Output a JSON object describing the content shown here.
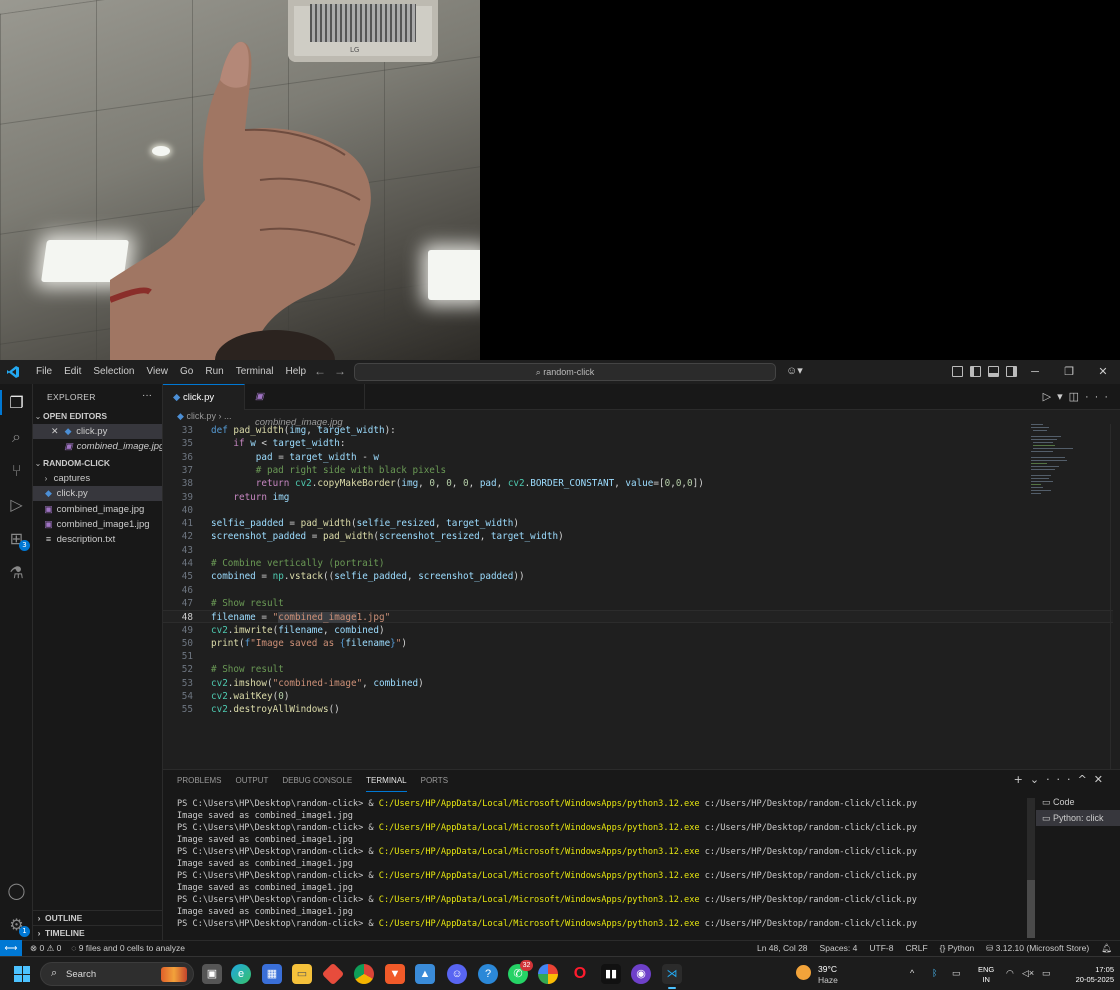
{
  "photo": {
    "vent_logo": "LG"
  },
  "titlebar": {
    "menu": [
      "File",
      "Edit",
      "Selection",
      "View",
      "Go",
      "Run",
      "Terminal",
      "Help"
    ],
    "search": "random-click"
  },
  "sidebar": {
    "title": "EXPLORER",
    "open_editors_label": "OPEN EDITORS",
    "open_editors": [
      "click.py",
      "combined_image.jpg"
    ],
    "folder_label": "RANDOM-CLICK",
    "items": [
      "captures",
      "click.py",
      "combined_image.jpg",
      "combined_image1.jpg",
      "description.txt"
    ],
    "outline_label": "OUTLINE",
    "timeline_label": "TIMELINE"
  },
  "activity": {
    "extensions_badge": "3",
    "settings_badge": "1"
  },
  "editor": {
    "tabs": [
      "click.py",
      "combined_image.jpg"
    ],
    "breadcrumb_file": "click.py",
    "breadcrumb_more": "...",
    "line_numbers": [
      "33",
      "35",
      "36",
      "37",
      "38",
      "39",
      "40",
      "41",
      "42",
      "43",
      "44",
      "45",
      "46",
      "47",
      "48",
      "49",
      "50",
      "51",
      "52",
      "53",
      "54",
      "55"
    ],
    "current_line": "48"
  },
  "panel": {
    "tabs": [
      "PROBLEMS",
      "OUTPUT",
      "DEBUG CONSOLE",
      "TERMINAL",
      "PORTS"
    ],
    "active_tab": "TERMINAL",
    "terminals": [
      "Code",
      "Python: click"
    ],
    "prompt": "PS C:\\Users\\HP\\Desktop\\random-click> & ",
    "exe": "C:/Users/HP/AppData/Local/Microsoft/WindowsApps/python3.12.exe",
    "script": " c:/Users/HP/Desktop/random-click/click.py",
    "output": "Image saved as combined_image1.jpg"
  },
  "statusbar": {
    "errors": "0",
    "warnings": "0",
    "analysis": "9 files and 0 cells to analyze",
    "position": "Ln 48, Col 28",
    "spaces": "Spaces: 4",
    "encoding": "UTF-8",
    "eol": "CRLF",
    "language": "Python",
    "interpreter": "3.12.10 (Microsoft Store)"
  },
  "taskbar": {
    "search": "Search",
    "whatsapp_count": "32",
    "weather_temp": "39°C",
    "weather_cond": "Haze",
    "lang1": "ENG",
    "lang2": "IN",
    "time": "17:05",
    "date": "20-05-2025"
  },
  "colors": {
    "accent": "#0078d4",
    "editor_bg": "#1f1f1f",
    "sidebar_bg": "#181818",
    "terminal_path": "#e5e510"
  }
}
